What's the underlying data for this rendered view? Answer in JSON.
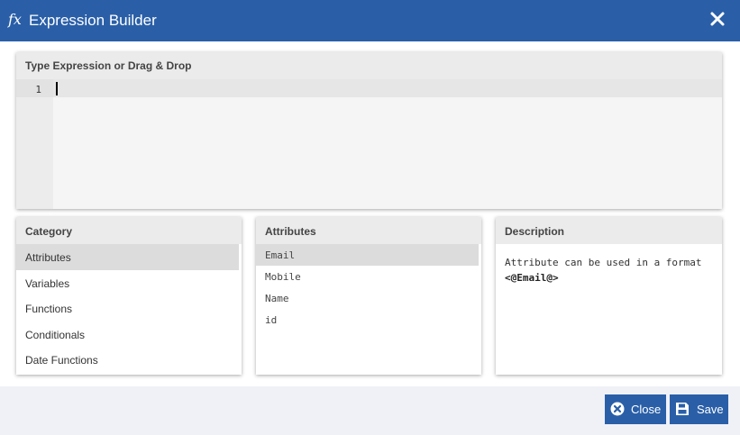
{
  "dialog": {
    "title": "Expression Builder",
    "fx_symbol": "fx"
  },
  "editor": {
    "header": "Type Expression or Drag & Drop",
    "line_number": "1"
  },
  "category": {
    "header": "Category",
    "items": [
      "Attributes",
      "Variables",
      "Functions",
      "Conditionals",
      "Date Functions"
    ],
    "selected": "Attributes"
  },
  "attributes": {
    "header": "Attributes",
    "items": [
      "Email",
      "Mobile",
      "Name",
      "id"
    ],
    "selected": "Email"
  },
  "description": {
    "header": "Description",
    "text": "Attribute can be used in a format",
    "format": "<@Email@>"
  },
  "footer": {
    "close_label": "Close",
    "save_label": "Save"
  },
  "colors": {
    "primary": "#2a5fa8",
    "header_bg": "#ebebeb",
    "selected_bg": "#dcdcdc"
  }
}
